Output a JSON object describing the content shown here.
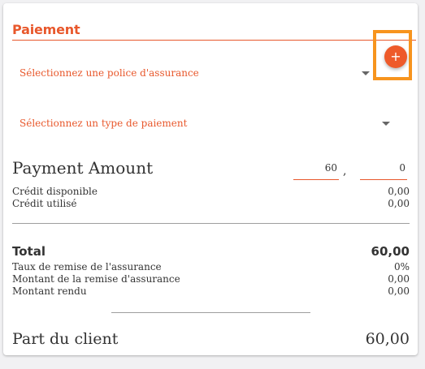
{
  "colors": {
    "accent": "#e8582c",
    "add_button": "#ee5a2a",
    "highlight": "#f7941e"
  },
  "payment": {
    "title": "Paiement",
    "policy_select": {
      "placeholder": "Sélectionnez une police d'assurance",
      "icon": "chevron-down-icon"
    },
    "add_button": {
      "label": "+",
      "icon": "plus-icon"
    },
    "type_select": {
      "placeholder": "Sélectionnez un type de paiement",
      "icon": "chevron-down-icon"
    },
    "amount": {
      "label": "Payment Amount",
      "integer_value": "60",
      "separator": ",",
      "decimal_value": "0"
    },
    "credit": [
      {
        "label": "Crédit disponible",
        "value": "0,00"
      },
      {
        "label": "Crédit utilisé",
        "value": "0,00"
      }
    ],
    "total": {
      "label": "Total",
      "value": "60,00"
    },
    "breakdown": [
      {
        "label": "Taux de remise de l'assurance",
        "value": "0%"
      },
      {
        "label": "Montant de la remise d'assurance",
        "value": "0,00"
      },
      {
        "label": "Montant rendu",
        "value": "0,00"
      }
    ],
    "client_share": {
      "label": "Part du client",
      "value": "60,00"
    }
  }
}
